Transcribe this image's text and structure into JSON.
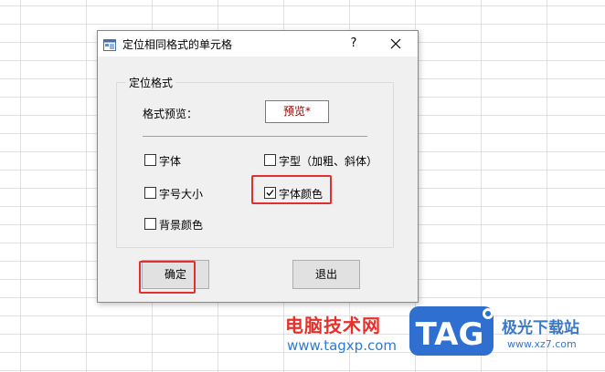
{
  "dialog": {
    "title": "定位相同格式的单元格",
    "help_label": "?",
    "group": {
      "title": "定位格式",
      "preview_label": "格式预览：",
      "preview_value": "预览*",
      "preview_color": "#8b0000"
    },
    "options": {
      "font": {
        "label": "字体",
        "checked": false
      },
      "font_style": {
        "label": "字型（加粗、斜体）",
        "checked": false
      },
      "font_size": {
        "label": "字号大小",
        "checked": false
      },
      "font_color": {
        "label": "字体颜色",
        "checked": true
      },
      "background_color": {
        "label": "背景颜色",
        "checked": false
      }
    },
    "buttons": {
      "ok": "确定",
      "exit": "退出"
    },
    "highlight_color": "#e03030"
  },
  "watermark": {
    "site_cn": "电脑技术网",
    "site_url": "www.tagxp.com",
    "logo_text": "TAG",
    "site2_cn": "极光下载站",
    "site2_url": "www.xz7.com"
  }
}
